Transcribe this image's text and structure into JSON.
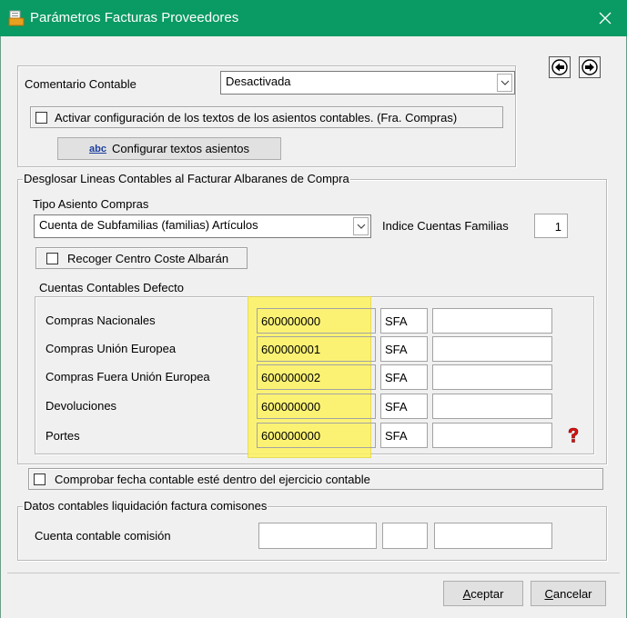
{
  "window": {
    "title": "Parámetros Facturas Proveedores"
  },
  "top": {
    "comentario_label": "Comentario Contable",
    "comentario_value": "Desactivada",
    "activar_checkbox_label": "Activar configuración de los textos de los asientos contables. (Fra. Compras)",
    "activar_checked": false,
    "configurar_button_label": "Configurar textos asientos",
    "configurar_icon_text": "abc"
  },
  "desglosar": {
    "legend": "Desglosar Lineas Contables al Facturar Albaranes de Compra",
    "tipo_asiento_label": "Tipo Asiento Compras",
    "tipo_asiento_value": "Cuenta de Subfamilias (familias) Artículos",
    "indice_label": "Indice Cuentas Familias",
    "indice_value": "1",
    "recoger_label": "Recoger Centro Coste Albarán",
    "recoger_checked": false
  },
  "cuentas": {
    "legend": "Cuentas Contables Defecto",
    "rows": [
      {
        "label": "Compras Nacionales",
        "account": "600000000",
        "code": "SFA",
        "extra": ""
      },
      {
        "label": "Compras Unión Europea",
        "account": "600000001",
        "code": "SFA",
        "extra": ""
      },
      {
        "label": "Compras Fuera Unión Europea",
        "account": "600000002",
        "code": "SFA",
        "extra": ""
      },
      {
        "label": "Devoluciones",
        "account": "600000000",
        "code": "SFA",
        "extra": ""
      },
      {
        "label": "Portes",
        "account": "600000000",
        "code": "SFA",
        "extra": ""
      }
    ]
  },
  "comprobar": {
    "label": "Comprobar fecha contable esté dentro del ejercicio contable",
    "checked": false
  },
  "comisiones": {
    "legend": "Datos contables liquidación factura comisones",
    "cuenta_label": "Cuenta contable comisión",
    "field1": "",
    "field2": "",
    "field3": ""
  },
  "buttons": {
    "aceptar_first": "A",
    "aceptar_rest": "ceptar",
    "cancelar_first": "C",
    "cancelar_rest": "ancelar"
  },
  "colors": {
    "titlebar": "#0a9a63",
    "highlight": "#fdf35f"
  },
  "icons": {
    "app": "document-folder-icon",
    "close": "close-icon",
    "prev": "arrow-left-icon",
    "next": "arrow-right-icon",
    "help": "red-question-icon"
  }
}
